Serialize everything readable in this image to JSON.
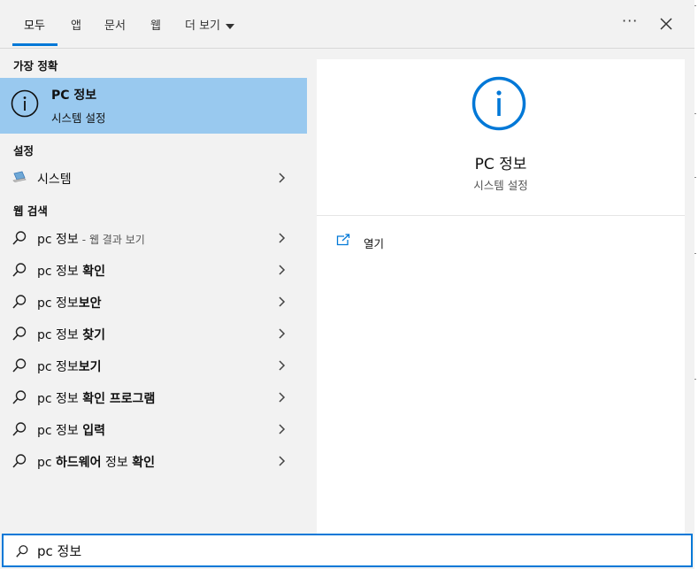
{
  "tabs": [
    {
      "label": "모두"
    },
    {
      "label": "앱"
    },
    {
      "label": "문서"
    },
    {
      "label": "웹"
    },
    {
      "label": "더 보기"
    }
  ],
  "header": {
    "more_options": "···"
  },
  "sections": {
    "best_match": "가장 정확",
    "settings": "설정",
    "web_search": "웹 검색"
  },
  "best_match": {
    "title": "PC 정보",
    "subtitle": "시스템 설정",
    "icon": "info-icon"
  },
  "settings_items": [
    {
      "label": "시스템",
      "icon": "laptop-icon"
    }
  ],
  "web_results": [
    {
      "prefix": "pc 정보",
      "bold": "",
      "suffix": "- 웹 결과 보기"
    },
    {
      "prefix": "pc 정보 ",
      "bold": "확인",
      "suffix": ""
    },
    {
      "prefix": "pc 정보",
      "bold": "보안",
      "suffix": ""
    },
    {
      "prefix": "pc 정보 ",
      "bold": "찾기",
      "suffix": ""
    },
    {
      "prefix": "pc 정보",
      "bold": "보기",
      "suffix": ""
    },
    {
      "prefix": "pc 정보 ",
      "bold": "확인 프로그램",
      "suffix": ""
    },
    {
      "prefix": "pc 정보 ",
      "bold": "입력",
      "suffix": ""
    },
    {
      "prefix": "pc ",
      "bold": "하드웨어",
      "suffix": "",
      "tail": " 정보 ",
      "bold2": "확인"
    }
  ],
  "preview": {
    "title": "PC 정보",
    "subtitle": "시스템 설정",
    "open_label": "열기"
  },
  "search": {
    "value": "pc 정보"
  },
  "colors": {
    "accent": "#0078d7",
    "selected": "#99c9ef",
    "panel": "#f2f2f2"
  }
}
